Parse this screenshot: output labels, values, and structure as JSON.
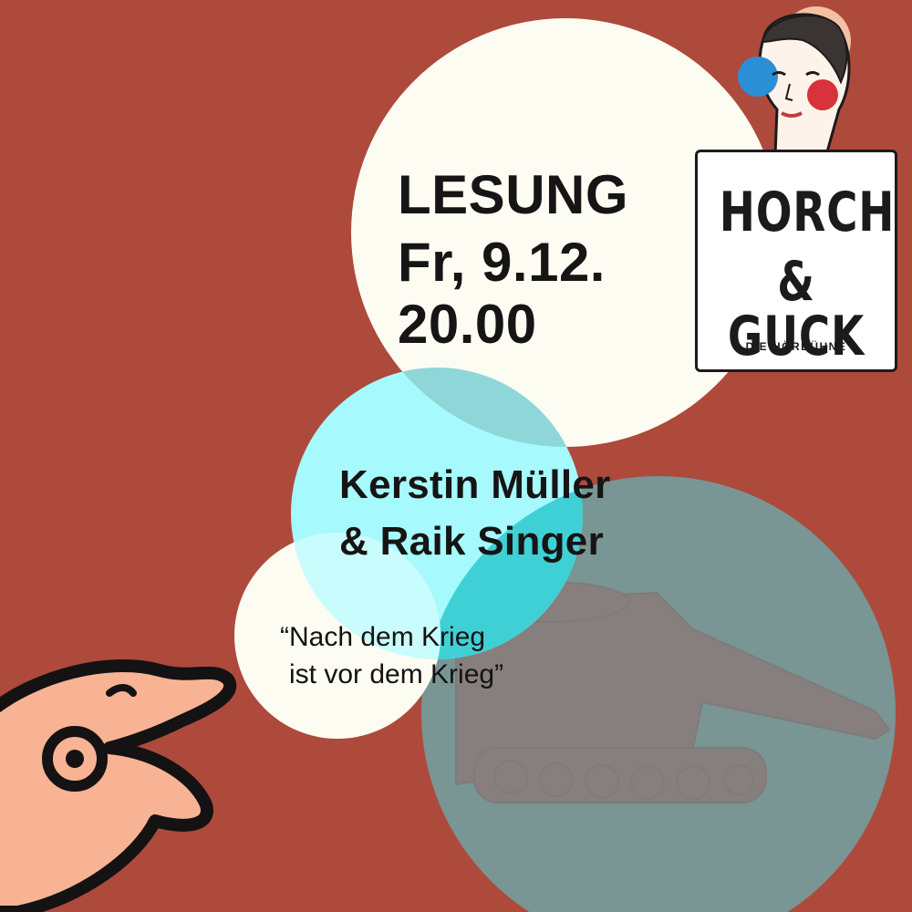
{
  "event": {
    "type": "LESUNG",
    "date": "Fr, 9.12.",
    "time": "20.00"
  },
  "authors": {
    "line_1": "Kerstin Müller",
    "line_2": "& Raik Singer"
  },
  "quote": {
    "line_1": "“Nach dem Krieg",
    "line_2": "ist vor dem Krieg”"
  },
  "logo": {
    "line_1": "HORCH",
    "line_2": "& GUCK",
    "tagline": "• DIE HÖRBÜHNE •"
  },
  "colors": {
    "background": "#ad4a3c",
    "cream": "#fdfcf2",
    "cyan": "#a6f9fc",
    "teal_grey": "#799594",
    "ink": "#161414",
    "fish_skin": "#f7b394",
    "logo_blue": "#2b8fd6",
    "logo_red": "#d8323c"
  },
  "icons": {
    "fish": "fish-icon",
    "tank": "tank-illustration",
    "woman": "woman-portrait-illustration"
  }
}
